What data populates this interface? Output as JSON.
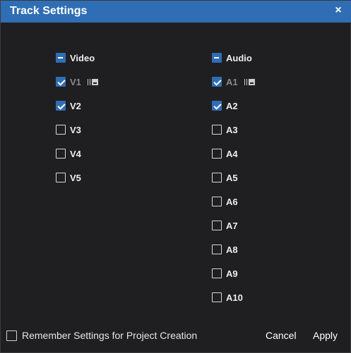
{
  "dialog": {
    "title": "Track Settings",
    "close_glyph": "×"
  },
  "video": {
    "header_label": "Video",
    "header_state": "mixed",
    "tracks": [
      {
        "label": "V1",
        "checked": true,
        "dimmed": true,
        "locked_icon": true
      },
      {
        "label": "V2",
        "checked": true,
        "dimmed": false,
        "locked_icon": false
      },
      {
        "label": "V3",
        "checked": false,
        "dimmed": false,
        "locked_icon": false
      },
      {
        "label": "V4",
        "checked": false,
        "dimmed": false,
        "locked_icon": false
      },
      {
        "label": "V5",
        "checked": false,
        "dimmed": false,
        "locked_icon": false
      }
    ]
  },
  "audio": {
    "header_label": "Audio",
    "header_state": "mixed",
    "tracks": [
      {
        "label": "A1",
        "checked": true,
        "dimmed": true,
        "locked_icon": true
      },
      {
        "label": "A2",
        "checked": true,
        "dimmed": false,
        "locked_icon": false
      },
      {
        "label": "A3",
        "checked": false,
        "dimmed": false,
        "locked_icon": false
      },
      {
        "label": "A4",
        "checked": false,
        "dimmed": false,
        "locked_icon": false
      },
      {
        "label": "A5",
        "checked": false,
        "dimmed": false,
        "locked_icon": false
      },
      {
        "label": "A6",
        "checked": false,
        "dimmed": false,
        "locked_icon": false
      },
      {
        "label": "A7",
        "checked": false,
        "dimmed": false,
        "locked_icon": false
      },
      {
        "label": "A8",
        "checked": false,
        "dimmed": false,
        "locked_icon": false
      },
      {
        "label": "A9",
        "checked": false,
        "dimmed": false,
        "locked_icon": false
      },
      {
        "label": "A10",
        "checked": false,
        "dimmed": false,
        "locked_icon": false
      }
    ]
  },
  "footer": {
    "remember_label": "Remember Settings for Project Creation",
    "remember_checked": false,
    "cancel_label": "Cancel",
    "apply_label": "Apply"
  },
  "colors": {
    "accent": "#2f6eb5",
    "background": "#1f1f21",
    "text": "#ededed",
    "dim_text": "#8a8a8a"
  }
}
